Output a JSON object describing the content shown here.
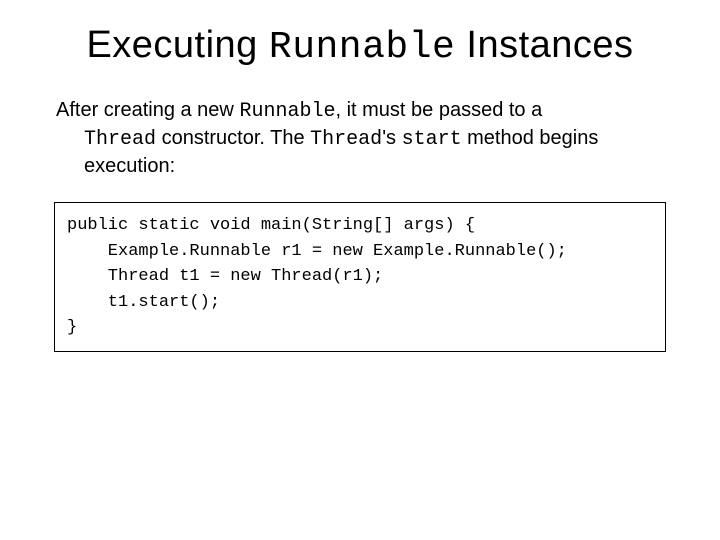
{
  "title": {
    "part1": "Executing ",
    "mono": "Runnable",
    "part2": " Instances"
  },
  "paragraph": {
    "t1": "After creating a new ",
    "m1": "Runnable",
    "t2": ", it must be passed to a ",
    "m2": "Thread",
    "t3": " constructor. The ",
    "m3": "Thread",
    "t4": "'s ",
    "m4": "start",
    "t5": " method begins execution:"
  },
  "code": "public static void main(String[] args) {\n    Example.Runnable r1 = new Example.Runnable();\n    Thread t1 = new Thread(r1);\n    t1.start();\n}"
}
